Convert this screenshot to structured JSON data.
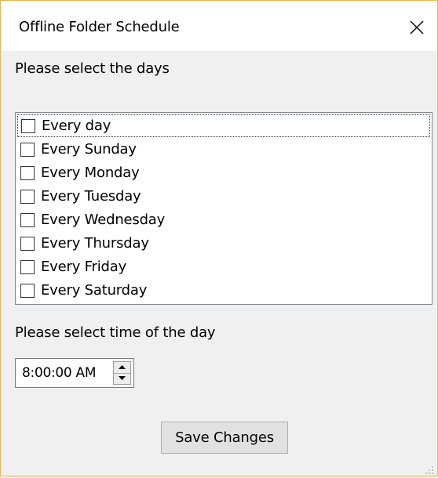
{
  "window": {
    "title": "Offline Folder Schedule"
  },
  "days_section": {
    "label": "Please select the days",
    "items": [
      {
        "label": "Every day",
        "checked": false
      },
      {
        "label": "Every Sunday",
        "checked": false
      },
      {
        "label": "Every Monday",
        "checked": false
      },
      {
        "label": "Every Tuesday",
        "checked": false
      },
      {
        "label": "Every Wednesday",
        "checked": false
      },
      {
        "label": "Every Thursday",
        "checked": false
      },
      {
        "label": "Every Friday",
        "checked": false
      },
      {
        "label": "Every Saturday",
        "checked": false
      }
    ]
  },
  "time_section": {
    "label": "Please select time of the day",
    "value": "8:00:00 AM"
  },
  "actions": {
    "save_label": "Save Changes"
  },
  "icons": {
    "close": "close-icon",
    "spin_up": "chevron-up-icon",
    "spin_down": "chevron-down-icon",
    "resize": "resize-grip-icon"
  }
}
